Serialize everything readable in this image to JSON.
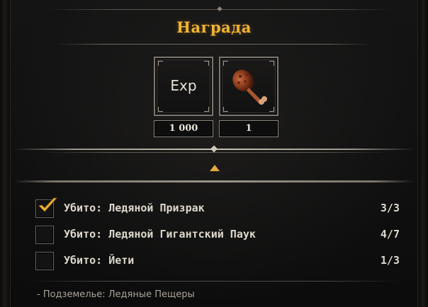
{
  "reward": {
    "title": "Награда",
    "items": [
      {
        "name": "exp",
        "label": "Exp",
        "count": "1 000",
        "icon": "exp-icon"
      },
      {
        "name": "meat",
        "count": "1",
        "icon": "meat-leg-icon"
      }
    ]
  },
  "quest": {
    "tasks": [
      {
        "label": "Убито: Ледяной Призрак",
        "progress": "3/3",
        "done": true
      },
      {
        "label": "Убито: Ледяной Гигантский Паук",
        "progress": "4/7",
        "done": false
      },
      {
        "label": "Убито: Йети",
        "progress": "1/3",
        "done": false
      }
    ],
    "location": "- Подземелье: Ледяные Пещеры"
  },
  "colors": {
    "title": "#f0b433",
    "accent": "#e3a93a",
    "text": "#ddd8cc"
  }
}
